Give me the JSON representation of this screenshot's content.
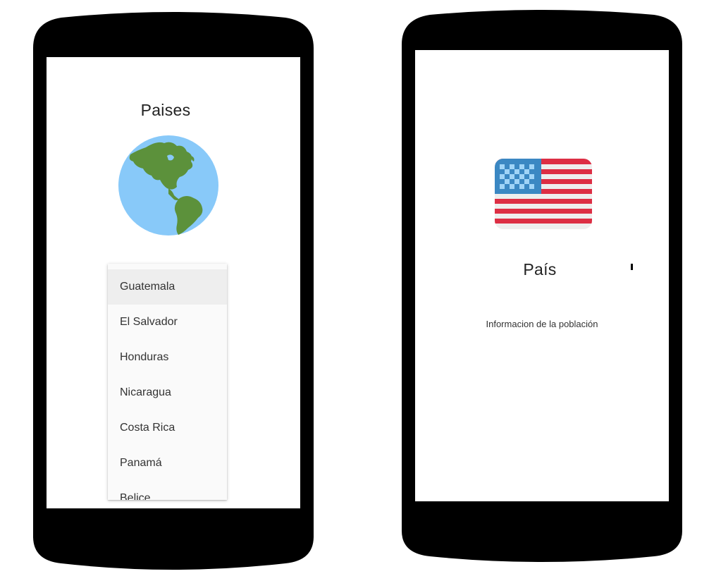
{
  "left_phone": {
    "title": "Paises",
    "globe_icon": "globe-americas-icon",
    "dropdown": {
      "selected_index": 0,
      "options": [
        "Guatemala",
        "El Salvador",
        "Honduras",
        "Nicaragua",
        "Costa Rica",
        "Panamá",
        "Belice"
      ]
    }
  },
  "right_phone": {
    "flag_icon": "us-flag-icon",
    "title": "País",
    "info": "Informacion de la población"
  },
  "colors": {
    "phone_frame": "#000000",
    "screen_bg": "#ffffff",
    "ocean": "#88c9f9",
    "land": "#5c913b",
    "flag_red": "#dd2e44",
    "flag_blue": "#3b88c3",
    "flag_star": "#a0d4f7",
    "dropdown_bg": "#fafafa",
    "dropdown_selected_bg": "#eeeeee"
  }
}
